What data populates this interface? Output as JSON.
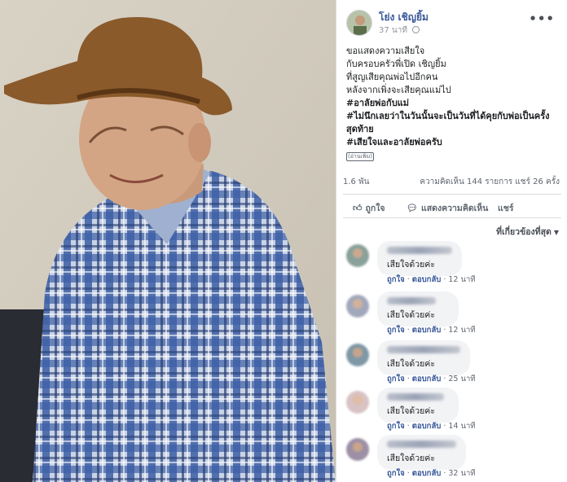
{
  "post": {
    "author": "โย่ง เชิญยิ้ม",
    "time": "37 นาที",
    "more_icon": "more-options-icon",
    "lines": [
      "ขอแสดงความเสียใจ",
      "กับครอบครัวพี่เปิด เชิญยิ้ม",
      "ที่สูญเสียคุณพ่อไปอีกคน",
      "หลังจากเพิ่งจะเสียคุณแม่ไป"
    ],
    "hashtags": [
      "#อาลัยพ่อกับแม่",
      "#ไม่นึกเลยว่าในวันนั้นจะเป็นวันที่ได้คุยกับพ่อเป็นครั้งสุดท้าย",
      "#เสียใจและอาลัยพ่อครับ"
    ],
    "see_more": "(อ่านเพิ่ม)"
  },
  "stats": {
    "likes": "1.6 พัน",
    "comments_shares": "ความคิดเห็น 144 รายการ  แชร์ 26 ครั้ง"
  },
  "actions": {
    "like": "ถูกใจ",
    "comment": "แสดงความคิดเห็น",
    "share": "แชร์"
  },
  "sort": {
    "label": "ที่เกี่ยวข้องที่สุด"
  },
  "comments": [
    {
      "text": "เสียใจด้วยค่ะ",
      "like": "ถูกใจ",
      "reply": "ตอบกลับ",
      "time": "12 นาที"
    },
    {
      "text": "เสียใจด้วยค่ะ",
      "like": "ถูกใจ",
      "reply": "ตอบกลับ",
      "time": "12 นาที"
    },
    {
      "text": "เสียใจด้วยค่ะ",
      "like": "ถูกใจ",
      "reply": "ตอบกลับ",
      "time": "25 นาที"
    },
    {
      "text": "เสียใจด้วยค่ะ",
      "like": "ถูกใจ",
      "reply": "ตอบกลับ",
      "time": "14 นาที"
    },
    {
      "text": "เสียใจด้วยค่ะ",
      "like": "ถูกใจ",
      "reply": "ตอบกลับ",
      "time": "32 นาที"
    }
  ],
  "colors": {
    "link": "#385898",
    "bubble": "#f2f3f5",
    "hat": "#8a5a2b",
    "shirt": "#4a6fb0"
  }
}
